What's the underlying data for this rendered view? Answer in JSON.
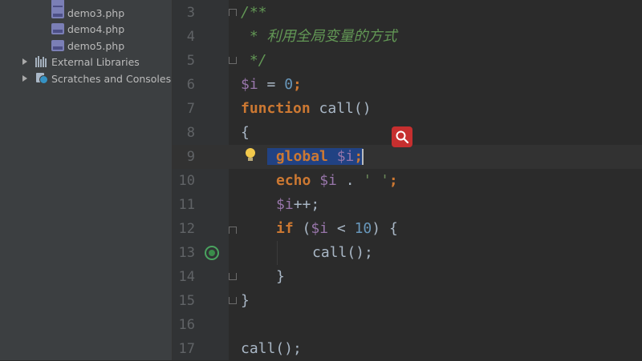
{
  "sidebar": {
    "files": [
      {
        "name": "demo3.php"
      },
      {
        "name": "demo4.php"
      },
      {
        "name": "demo5.php"
      }
    ],
    "external_libraries": "External Libraries",
    "scratches": "Scratches and Consoles"
  },
  "editor": {
    "line_numbers": [
      "3",
      "4",
      "5",
      "6",
      "7",
      "8",
      "9",
      "10",
      "11",
      "12",
      "13",
      "14",
      "15",
      "16",
      "17"
    ],
    "code": {
      "l3": "/**",
      "l4": " * 利用全局变量的方式",
      "l5": " */",
      "l6_var": "$i",
      "l6_op": " = ",
      "l6_num": "0",
      "l6_end": ";",
      "l7_kw": "function",
      "l7_rest": " call()",
      "l8": "{",
      "l9_kw": "global",
      "l9_var": " $i",
      "l9_end": ";",
      "l10_kw": "echo",
      "l10_var": " $i",
      "l10_mid": " . ",
      "l10_str": "' '",
      "l10_end": ";",
      "l11_var": "$i",
      "l11_rest": "++;",
      "l12_kw": "if",
      "l12_a": " (",
      "l12_var": "$i",
      "l12_b": " < ",
      "l12_num": "10",
      "l12_c": ") {",
      "l13": "call();",
      "l14": "}",
      "l15": "}",
      "l17": "call();"
    }
  },
  "colors": {
    "background": "#2b2b2b",
    "keyword": "#cc7832",
    "variable": "#9876aa",
    "number": "#6897bb",
    "comment": "#629755",
    "selection": "#214283"
  }
}
